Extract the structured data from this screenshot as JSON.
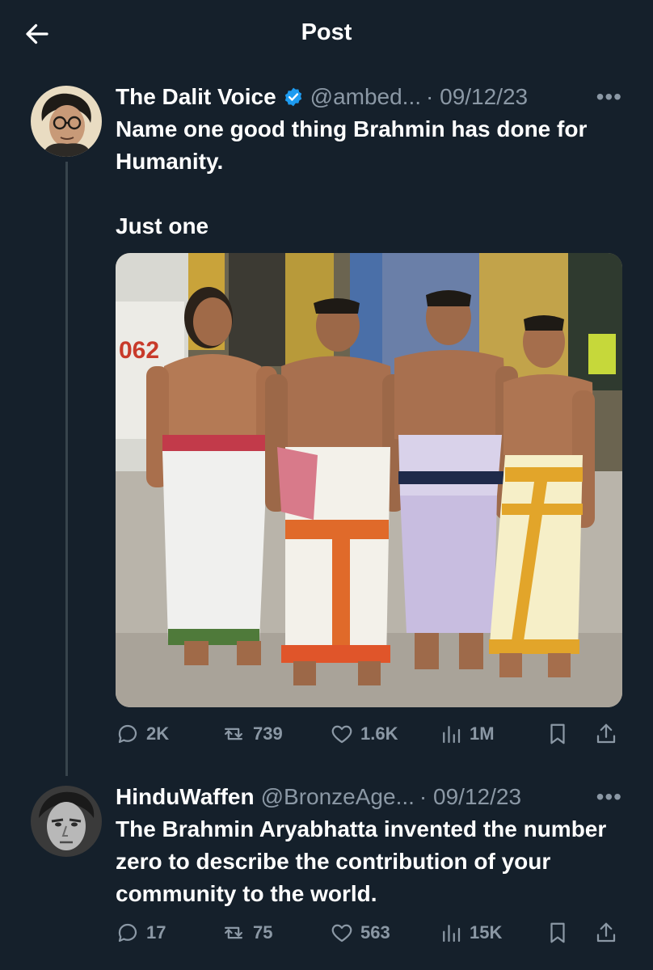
{
  "header": {
    "title": "Post",
    "back_icon": "arrow-left-icon"
  },
  "tweets": [
    {
      "display_name": "The Dalit Voice",
      "verified": true,
      "handle": "@ambed...",
      "date": "· 09/12/23",
      "text": "Name one good thing Brahmin has done for Humanity.\n\nJust one",
      "has_photo": true,
      "stats": {
        "replies": "2K",
        "reposts": "739",
        "likes": "1.6K",
        "views": "1M"
      }
    },
    {
      "display_name": "HinduWaffen",
      "verified": false,
      "handle": "@BronzeAge...",
      "date": "· 09/12/23",
      "text": "The Brahmin Aryabhatta invented the number zero to describe the contribution of your community to the world.",
      "has_photo": false,
      "stats": {
        "replies": "17",
        "reposts": "75",
        "likes": "563",
        "views": "15K"
      }
    }
  ],
  "photo": {
    "sign_number": "062"
  },
  "colors": {
    "background": "#15202b",
    "text": "#ffffff",
    "muted": "#8b98a5",
    "verified": "#1d9bf0",
    "thread_line": "#38444d"
  }
}
